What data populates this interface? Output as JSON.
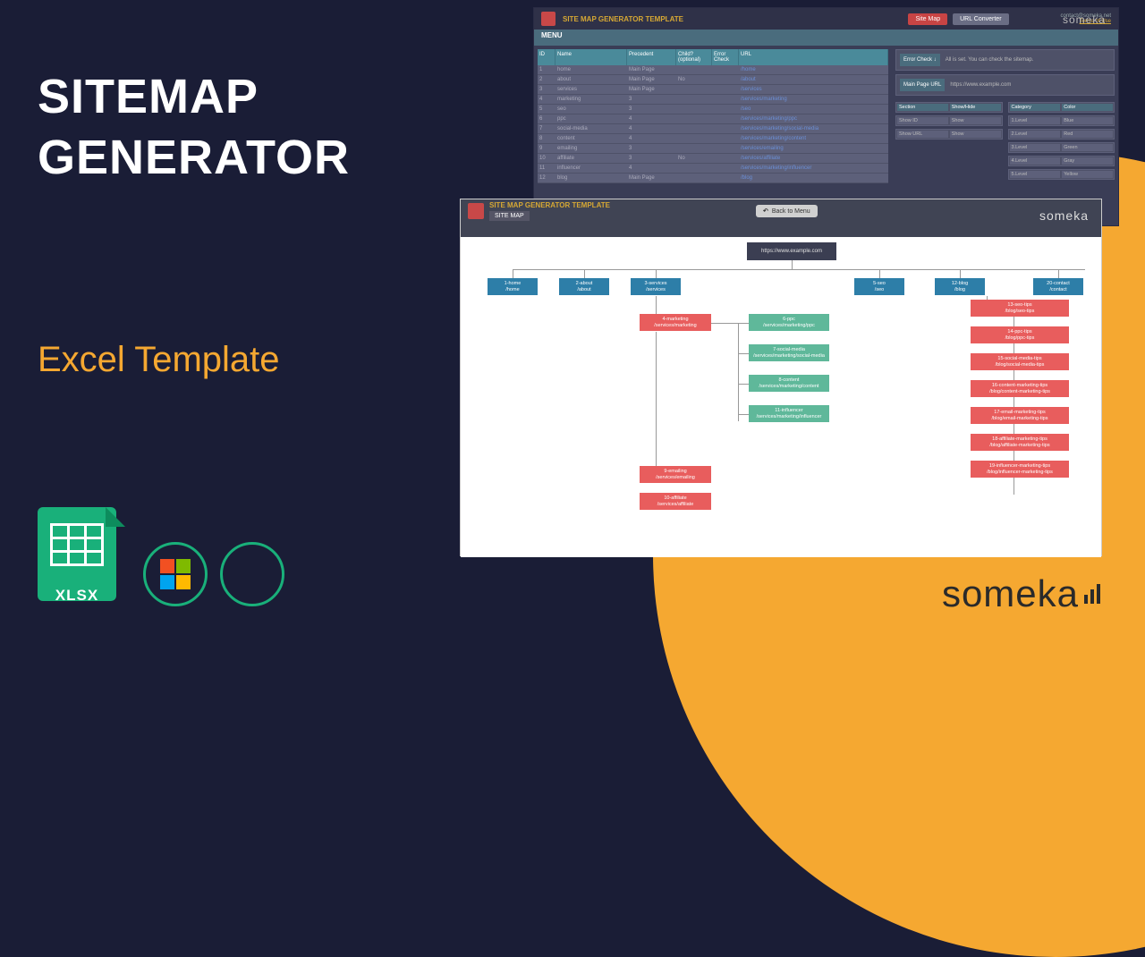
{
  "hero": {
    "title_line1": "SITEMAP",
    "title_line2": "GENERATOR",
    "subtitle": "Excel Template",
    "xlsx_label": "XLSX"
  },
  "brand": "someka",
  "screenshot1": {
    "template_title": "SITE MAP GENERATOR TEMPLATE",
    "menu_label": "MENU",
    "btn_sitemap": "Site Map",
    "btn_urlconverter": "URL Converter",
    "contact": "contact@someka.net",
    "terms": "Terms of Use",
    "headers": {
      "id": "ID",
      "name": "Name",
      "precedent": "Precedent",
      "child": "Child? (optional)",
      "error": "Error Check",
      "url": "URL"
    },
    "rows": [
      {
        "id": "1",
        "name": "home",
        "prec": "Main Page",
        "child": "",
        "url": "/home"
      },
      {
        "id": "2",
        "name": "about",
        "prec": "Main Page",
        "child": "No",
        "url": "/about"
      },
      {
        "id": "3",
        "name": "services",
        "prec": "Main Page",
        "child": "",
        "url": "/services"
      },
      {
        "id": "4",
        "name": "marketing",
        "prec": "3",
        "child": "",
        "url": "/services/marketing"
      },
      {
        "id": "5",
        "name": "seo",
        "prec": "3",
        "child": "",
        "url": "/seo"
      },
      {
        "id": "6",
        "name": "ppc",
        "prec": "4",
        "child": "",
        "url": "/services/marketing/ppc"
      },
      {
        "id": "7",
        "name": "social-media",
        "prec": "4",
        "child": "",
        "url": "/services/marketing/social-media"
      },
      {
        "id": "8",
        "name": "content",
        "prec": "4",
        "child": "",
        "url": "/services/marketing/content"
      },
      {
        "id": "9",
        "name": "emailing",
        "prec": "3",
        "child": "",
        "url": "/services/emailing"
      },
      {
        "id": "10",
        "name": "affiliate",
        "prec": "3",
        "child": "No",
        "url": "/services/affiliate"
      },
      {
        "id": "11",
        "name": "influencer",
        "prec": "4",
        "child": "",
        "url": "/services/marketing/influencer"
      },
      {
        "id": "12",
        "name": "blog",
        "prec": "Main Page",
        "child": "",
        "url": "/blog"
      }
    ],
    "sidebar": {
      "error_check_title": "Error Check ↓",
      "error_check_msg": "All is set. You can check the sitemap.",
      "mainpage_label": "Main Page URL",
      "mainpage_value": "https://www.example.com",
      "section_hdr": "Section",
      "showhide_hdr": "Show/Hide",
      "category_hdr": "Category",
      "color_hdr": "Color",
      "section_rows": [
        {
          "k": "Show ID",
          "v": "Show"
        },
        {
          "k": "Show URL",
          "v": "Show"
        }
      ],
      "level_rows": [
        {
          "k": "1.Level",
          "v": "Blue"
        },
        {
          "k": "2.Level",
          "v": "Red"
        },
        {
          "k": "3.Level",
          "v": "Green"
        },
        {
          "k": "4.Level",
          "v": "Gray"
        },
        {
          "k": "5.Level",
          "v": "Yellow"
        }
      ]
    }
  },
  "screenshot2": {
    "template_title": "SITE MAP GENERATOR TEMPLATE",
    "tab_label": "SITE MAP",
    "back_label": "Back to Menu",
    "root_url": "https://www.example.com",
    "l1": [
      {
        "t": "1-home",
        "s": "/home"
      },
      {
        "t": "2-about",
        "s": "/about"
      },
      {
        "t": "3-services",
        "s": "/services"
      },
      {
        "t": "5-seo",
        "s": "/seo"
      },
      {
        "t": "12-blog",
        "s": "/blog"
      },
      {
        "t": "20-contact",
        "s": "/contact"
      }
    ],
    "svc_child": {
      "t": "4-marketing",
      "s": "/services/marketing"
    },
    "svc_greens": [
      {
        "t": "6-ppc",
        "s": "/services/marketing/ppc"
      },
      {
        "t": "7-social-media",
        "s": "/services/marketing/social-media"
      },
      {
        "t": "8-content",
        "s": "/services/marketing/content"
      },
      {
        "t": "11-influencer",
        "s": "/services/marketing/influencer"
      }
    ],
    "svc_reds": [
      {
        "t": "9-emailing",
        "s": "/services/emailing"
      },
      {
        "t": "10-affiliate",
        "s": "/services/affiliate"
      }
    ],
    "blog_reds": [
      {
        "t": "13-seo-tips",
        "s": "/blog/seo-tips"
      },
      {
        "t": "14-ppc-tips",
        "s": "/blog/ppc-tips"
      },
      {
        "t": "15-social-media-tips",
        "s": "/blog/social-media-tips"
      },
      {
        "t": "16-content-marketing-tips",
        "s": "/blog/content-marketing-tips"
      },
      {
        "t": "17-email-marketing-tips",
        "s": "/blog/email-marketing-tips"
      },
      {
        "t": "18-affiliate-marketing-tips",
        "s": "/blog/affiliate-marketing-tips"
      },
      {
        "t": "19-influencer-marketing-tips",
        "s": "/blog/influencer-marketing-tips"
      }
    ]
  }
}
